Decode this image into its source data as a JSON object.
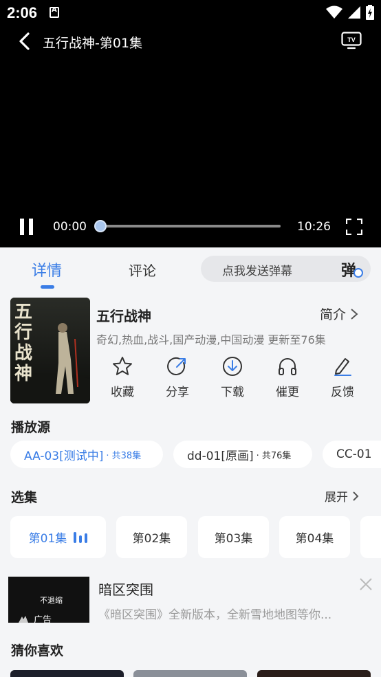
{
  "status_bar": {
    "time": "2:06"
  },
  "player": {
    "title": "五行战神-第01集",
    "current_time": "00:00",
    "total_time": "10:26",
    "progress_fraction": 0.0
  },
  "tabs": {
    "detail": "详情",
    "comments": "评论",
    "danmaku_placeholder": "点我发送弹幕",
    "danmaku_icon_char": "弹"
  },
  "show": {
    "title": "五行战神",
    "intro_label": "简介",
    "tags": "奇幻,热血,战斗,国产动漫,中国动漫 更新至76集",
    "poster_text": "五行战神"
  },
  "actions": [
    {
      "label": "收藏",
      "icon": "star-icon"
    },
    {
      "label": "分享",
      "icon": "share-icon"
    },
    {
      "label": "下载",
      "icon": "download-icon"
    },
    {
      "label": "催更",
      "icon": "headphones-icon"
    },
    {
      "label": "反馈",
      "icon": "edit-icon"
    }
  ],
  "sources": {
    "title": "播放源",
    "items": [
      {
        "name": "AA-03[测试中]",
        "count": "· 共38集",
        "active": true
      },
      {
        "name": "dd-01[原画]",
        "count": "· 共76集",
        "active": false
      },
      {
        "name": "CC-01",
        "count": "",
        "active": false
      }
    ]
  },
  "episodes": {
    "title": "选集",
    "expand_label": "展开",
    "items": [
      "第01集",
      "第02集",
      "第03集",
      "第04集"
    ],
    "active_index": 0
  },
  "ad": {
    "title": "暗区突围",
    "description": "《暗区突围》全新版本，全新雪地地图等你...",
    "badge": "广告",
    "thumb_text": "不退缩"
  },
  "recommend": {
    "title": "猜你喜欢"
  },
  "colors": {
    "accent": "#3a7de6",
    "background": "#f4f5f7",
    "player_bg": "#000000"
  }
}
